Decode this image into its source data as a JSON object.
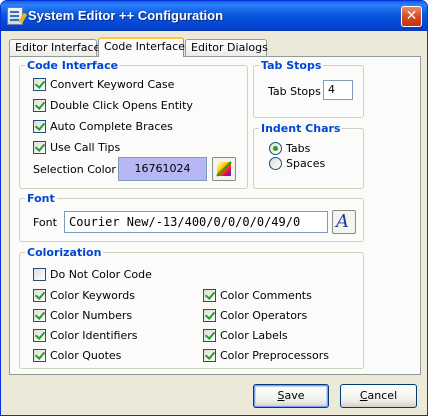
{
  "window": {
    "title": "System Editor ++ Configuration"
  },
  "tabs": [
    {
      "label": "Editor Interface",
      "active": false
    },
    {
      "label": "Code Interface",
      "active": true
    },
    {
      "label": "Editor Dialogs",
      "active": false
    }
  ],
  "code_interface": {
    "title": "Code Interface",
    "options": [
      {
        "label": "Convert Keyword Case",
        "checked": true
      },
      {
        "label": "Double Click Opens Entity",
        "checked": true
      },
      {
        "label": "Auto Complete Braces",
        "checked": true
      },
      {
        "label": "Use Call Tips",
        "checked": true
      }
    ],
    "selection_color_label": "Selection Color",
    "selection_color_value": "16761024",
    "selection_color_swatch": "#b7b7f5"
  },
  "tab_stops": {
    "title": "Tab Stops",
    "label": "Tab Stops",
    "value": "4"
  },
  "indent_chars": {
    "title": "Indent Chars",
    "options": [
      {
        "label": "Tabs",
        "selected": true
      },
      {
        "label": "Spaces",
        "selected": false
      }
    ]
  },
  "font": {
    "title": "Font",
    "label": "Font",
    "value": "Courier New/-13/400/0/0/0/0/49/0"
  },
  "colorization": {
    "title": "Colorization",
    "do_not_color": {
      "label": "Do Not Color Code",
      "checked": false
    },
    "left": [
      {
        "label": "Color Keywords",
        "checked": true
      },
      {
        "label": "Color Numbers",
        "checked": true
      },
      {
        "label": "Color Identifiers",
        "checked": true
      },
      {
        "label": "Color Quotes",
        "checked": true
      }
    ],
    "right": [
      {
        "label": "Color Comments",
        "checked": true
      },
      {
        "label": "Color Operators",
        "checked": true
      },
      {
        "label": "Color Labels",
        "checked": true
      },
      {
        "label": "Color Preprocessors",
        "checked": true
      }
    ]
  },
  "buttons": {
    "save": {
      "label": "Save",
      "mnemonic": "S",
      "rest": "ave"
    },
    "cancel": {
      "label": "Cancel",
      "mnemonic": "C",
      "rest": "ancel"
    }
  },
  "colors": {
    "title_bar": "#0345d4",
    "group_title": "#0046d5",
    "check": "#21a121",
    "active_tab": "#ffc83c"
  },
  "icons": {
    "window": "editor-window-icon",
    "close": "close-icon",
    "color_picker": "color-palette-icon",
    "font_picker": "font-icon"
  }
}
